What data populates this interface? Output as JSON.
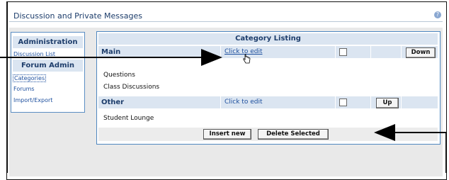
{
  "header": {
    "title": "Discussion and Private Messages",
    "help_icon": "help-icon"
  },
  "sidebar": {
    "administration_heading": "Administration",
    "discussion_list": "Discussion List",
    "forum_admin_heading": "Forum Admin",
    "links": [
      "Categories",
      "Forums",
      "Import/Export"
    ],
    "selected": "Categories"
  },
  "main": {
    "heading": "Category Listing",
    "categories": [
      {
        "name": "Main",
        "edit_label": "Click to edit",
        "button": "Down",
        "forums": [
          "Questions",
          "Class Discussions"
        ]
      },
      {
        "name": "Other",
        "edit_label": "Click to edit",
        "button": "Up",
        "forums": [
          "Student Lounge"
        ]
      }
    ],
    "insert_button": "Insert new",
    "delete_button": "Delete Selected"
  },
  "colors": {
    "accent": "#4f87c0",
    "heading_bg": "#dbe5f1",
    "link": "#1d4f9e"
  }
}
